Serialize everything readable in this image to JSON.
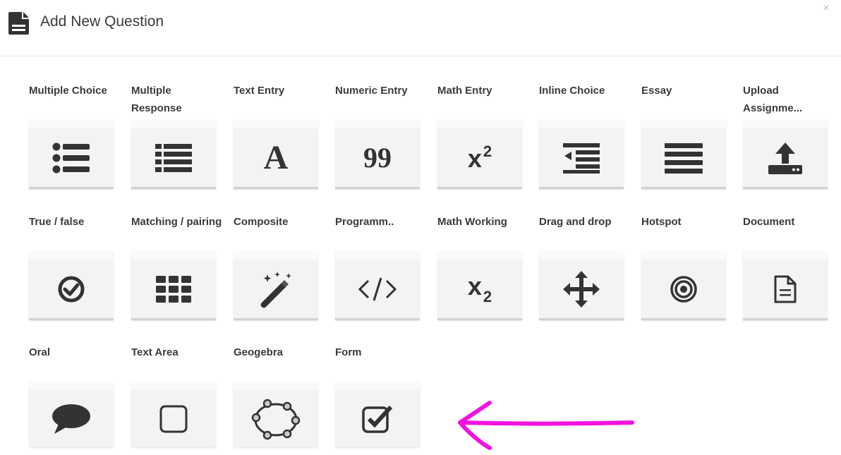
{
  "dialog": {
    "title": "Add New Question",
    "close_glyph": "×"
  },
  "tiles": [
    {
      "label": "Multiple Choice",
      "icon": "list-bullet-icon"
    },
    {
      "label": "Multiple Response",
      "icon": "list-square-icon"
    },
    {
      "label": "Text Entry",
      "icon": "letter-a-icon",
      "glyph": "A"
    },
    {
      "label": "Numeric Entry",
      "icon": "number-99-icon",
      "glyph": "99"
    },
    {
      "label": "Math Entry",
      "icon": "superscript-icon",
      "glyph": "x",
      "sup": "2"
    },
    {
      "label": "Inline Choice",
      "icon": "outdent-list-icon"
    },
    {
      "label": "Essay",
      "icon": "paragraph-lines-icon"
    },
    {
      "label": "Upload Assignme...",
      "icon": "upload-icon"
    },
    {
      "label": "True / false",
      "icon": "check-circle-icon"
    },
    {
      "label": "Matching / pairing",
      "icon": "grid-icon"
    },
    {
      "label": "Composite",
      "icon": "magic-wand-icon"
    },
    {
      "label": "Programm..",
      "icon": "code-icon",
      "glyph": "</>"
    },
    {
      "label": "Math Working",
      "icon": "subscript-icon",
      "glyph": "x",
      "sub": "2"
    },
    {
      "label": "Drag and drop",
      "icon": "move-arrows-icon"
    },
    {
      "label": "Hotspot",
      "icon": "target-icon"
    },
    {
      "label": "Document",
      "icon": "file-text-icon"
    },
    {
      "label": "Oral",
      "icon": "speech-bubble-icon"
    },
    {
      "label": "Text Area",
      "icon": "empty-square-icon"
    },
    {
      "label": "Geogebra",
      "icon": "geogebra-icon"
    },
    {
      "label": "Form",
      "icon": "check-square-icon"
    }
  ],
  "annotation": {
    "icon": "arrow-left-icon",
    "color": "#f212e0"
  }
}
